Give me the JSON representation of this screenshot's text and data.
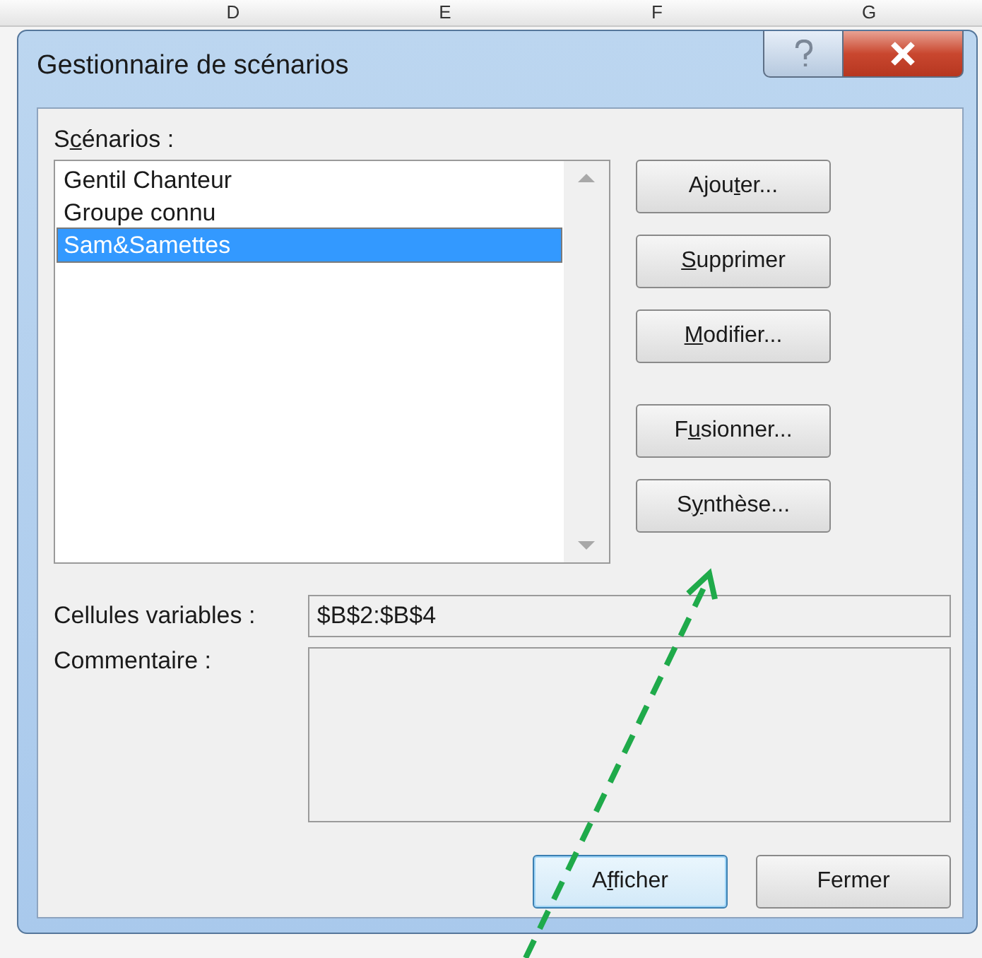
{
  "sheet": {
    "columns": [
      "D",
      "E",
      "F",
      "G"
    ]
  },
  "window": {
    "title": "Gestionnaire de scénarios"
  },
  "scenarios": {
    "label": {
      "before": "S",
      "key": "c",
      "after": "énarios :"
    },
    "items": [
      {
        "name": "Gentil Chanteur",
        "selected": false
      },
      {
        "name": "Groupe connu",
        "selected": false
      },
      {
        "name": "Sam&Samettes",
        "selected": true
      }
    ]
  },
  "side_button_groups": [
    {
      "buttons": [
        {
          "label": {
            "before": "Ajou",
            "key": "t",
            "after": "er..."
          }
        },
        {
          "label": {
            "key": "S",
            "after": "upprimer"
          }
        },
        {
          "label": {
            "key": "M",
            "after": "odifier..."
          }
        }
      ]
    },
    {
      "buttons": [
        {
          "label": {
            "before": "F",
            "key": "u",
            "after": "sionner..."
          }
        },
        {
          "label": {
            "before": "S",
            "key": "y",
            "after": "nthèse..."
          }
        }
      ]
    }
  ],
  "changing_cells": {
    "label": "Cellules variables :",
    "value": "$B$2:$B$4"
  },
  "comment": {
    "label": "Commentaire :"
  },
  "bottom_buttons": [
    {
      "label": {
        "before": "A",
        "key": "f",
        "after": "ficher"
      },
      "default": true
    },
    {
      "label": {
        "before": "Fermer"
      },
      "default": false
    }
  ]
}
